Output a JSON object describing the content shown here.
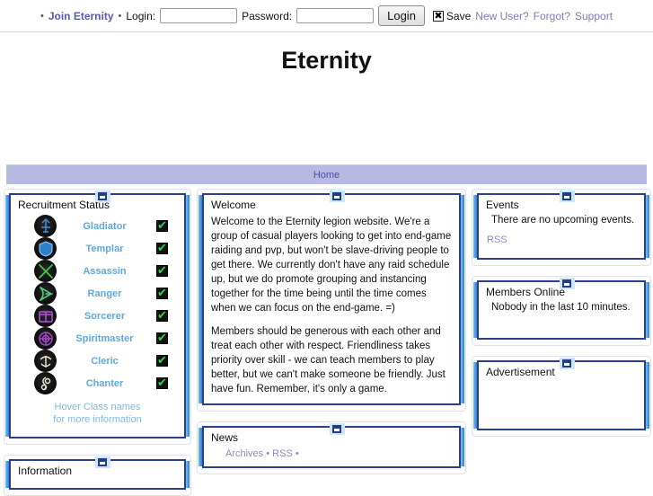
{
  "topbar": {
    "bullet": "•",
    "join_label": "Join Eternity",
    "login_label": "Login:",
    "login_value": "",
    "login_placeholder": "",
    "password_label": "Password:",
    "password_value": "",
    "password_placeholder": "",
    "login_button": "Login",
    "save_checkbox_glyph": "✖",
    "save_label": "Save",
    "new_user_label": "New User?",
    "forgot_label": "Forgot?",
    "support_label": "Support"
  },
  "site": {
    "title": "Eternity"
  },
  "nav": {
    "items": [
      {
        "label": "Home"
      }
    ]
  },
  "recruitment": {
    "title": "Recruitment Status",
    "check_glyph": "✔",
    "classes": [
      {
        "name": "Gladiator",
        "icon": "gladiator-class-icon",
        "color": "#3d8fd4",
        "open": true
      },
      {
        "name": "Templar",
        "icon": "templar-class-icon",
        "color": "#2f7fcf",
        "open": true
      },
      {
        "name": "Assassin",
        "icon": "assassin-class-icon",
        "color": "#46c24e",
        "open": true
      },
      {
        "name": "Ranger",
        "icon": "ranger-class-icon",
        "color": "#4fca7a",
        "open": true
      },
      {
        "name": "Sorcerer",
        "icon": "sorcerer-class-icon",
        "color": "#b253d6",
        "open": true
      },
      {
        "name": "Spiritmaster",
        "icon": "spiritmaster-class-icon",
        "color": "#a646c9",
        "open": true
      },
      {
        "name": "Cleric",
        "icon": "cleric-class-icon",
        "color": "#efeccd",
        "open": true
      },
      {
        "name": "Chanter",
        "icon": "chanter-class-icon",
        "color": "#efeccd",
        "open": true
      }
    ],
    "hover_note_line1": "Hover Class names",
    "hover_note_line2": "for more information"
  },
  "welcome": {
    "title": "Welcome",
    "paragraph1": "Welcome to the Eternity legion website. We're a group of casual players looking to get into end-game raiding and pvp, but won't be slave-driving people to get there. We currently don't have any raid schedule up, but we do promote grouping and instancing together for the time being until the time comes when we can focus on the end-game. =)",
    "paragraph2": "Members should be generous with each other and treat each other with respect. Friendliness takes priority over skill - we can teach members to play better, but we can't make someone be friendly. Just have fun. Remember, it's only a game."
  },
  "news": {
    "title": "News",
    "archives_label": "Archives",
    "rss_label": "RSS",
    "separator": "•"
  },
  "events": {
    "title": "Events",
    "empty_text": "There are no upcoming events.",
    "rss_label": "RSS"
  },
  "members_online": {
    "title": "Members Online",
    "empty_text": "Nobody in the last 10 minutes."
  },
  "advertisement": {
    "title": "Advertisement"
  },
  "information": {
    "title": "Information"
  },
  "colors": {
    "nav_bar": "#b7b9e0",
    "nav_text": "#4e4ea8",
    "panel_border_dark": "#2b3f8f",
    "panel_edge_blue": "#2f7fd6",
    "class_name": "#5fa8dd",
    "link": "#8a8ac4",
    "join_link": "#5a5ab5",
    "check_green": "#2fd14a"
  }
}
